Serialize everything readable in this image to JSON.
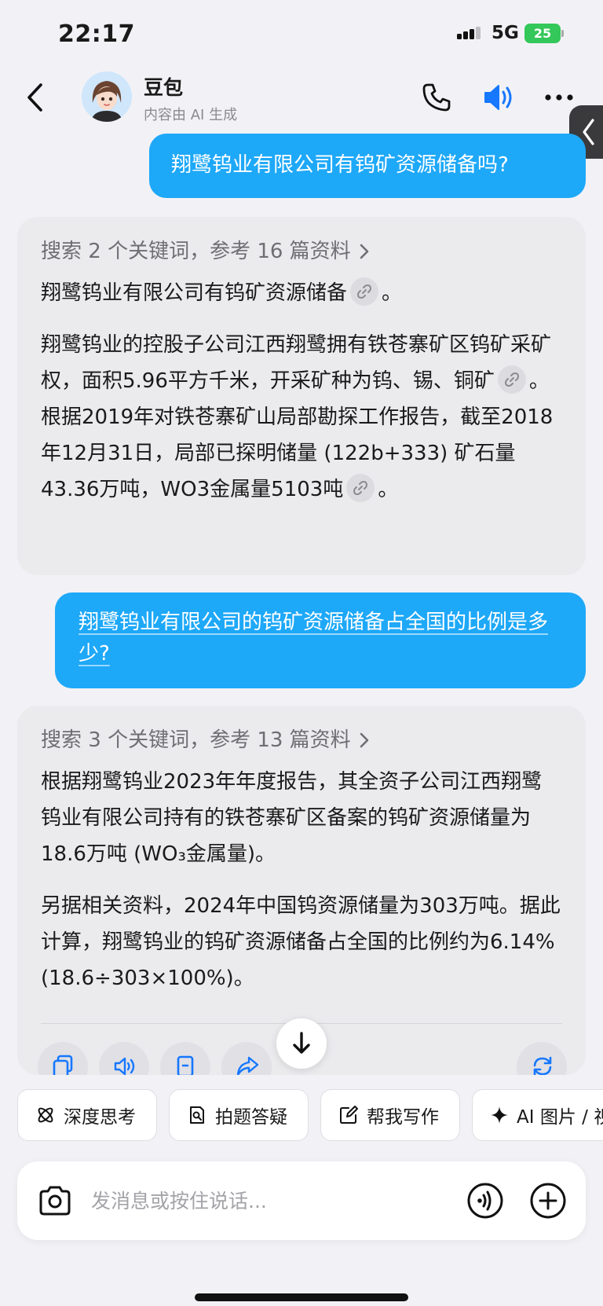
{
  "status_bar": {
    "time": "22:17",
    "network": "5G",
    "battery": "25"
  },
  "header": {
    "bot_name": "豆包",
    "subtitle": "内容由 AI 生成"
  },
  "messages": [
    {
      "role": "user",
      "text": "翔鹭钨业有限公司有钨矿资源储备吗?"
    },
    {
      "role": "assistant",
      "search_summary": "搜索 2 个关键词，参考 16 篇资料",
      "para1": "翔鹭钨业有限公司有钨矿资源储备",
      "para1_end": "。",
      "para2a": "翔鹭钨业的控股子公司江西翔鹭拥有铁苍寨矿区钨矿采矿权，面积5.96平方千米，开采矿种为钨、锡、铜矿",
      "para2b": "。根据2019年对铁苍寨矿山局部勘探工作报告，截至2018年12月31日，局部已探明储量 (122b+333) 矿石量43.36万吨，WO3金属量5103吨",
      "para2_end": "。"
    },
    {
      "role": "user",
      "text": "翔鹭钨业有限公司的钨矿资源储备占全国的比例是多少?"
    },
    {
      "role": "assistant",
      "search_summary": "搜索 3 个关键词，参考 13 篇资料",
      "para1": "根据翔鹭钨业2023年年度报告，其全资子公司江西翔鹭钨业有限公司持有的铁苍寨矿区备案的钨矿资源储量为18.6万吨 (WO₃金属量)。",
      "para2": "另据相关资料，2024年中国钨资源储量为303万吨。据此计算，翔鹭钨业的钨矿资源储备占全国的比例约为6.14% (18.6÷303×100%)。"
    }
  ],
  "quick_actions": [
    {
      "label": "深度思考",
      "icon": "atom-icon"
    },
    {
      "label": "拍题答疑",
      "icon": "photo-question-icon"
    },
    {
      "label": "帮我写作",
      "icon": "edit-icon"
    },
    {
      "label": "AI 图片 / 视",
      "icon": "sparkle-icon"
    }
  ],
  "input": {
    "placeholder": "发消息或按住说话..."
  },
  "colors": {
    "user_bubble": "#1ea8f8",
    "card_bg": "#ebebee",
    "accent": "#1677ff"
  }
}
